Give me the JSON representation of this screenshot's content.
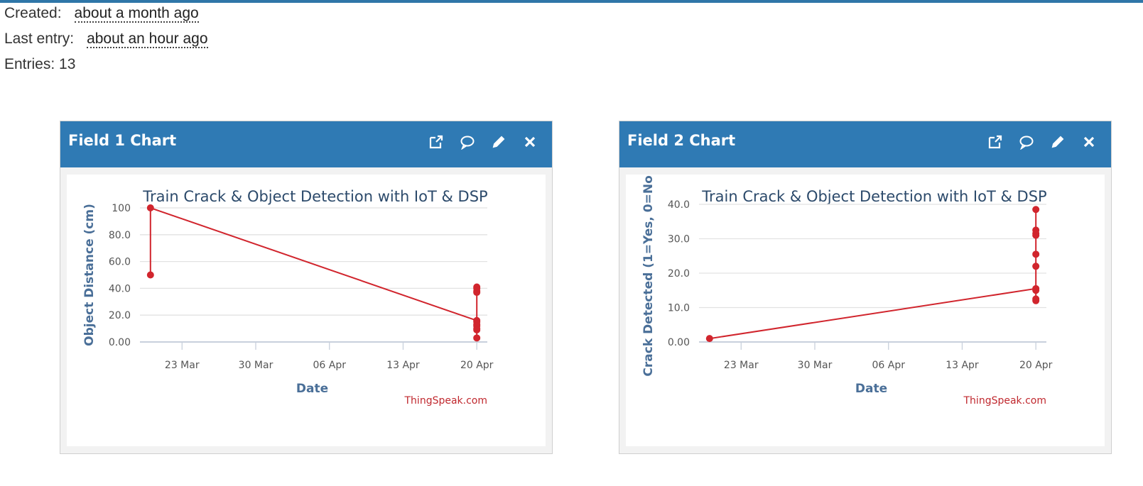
{
  "meta": {
    "created_label": "Created:",
    "created_value": "about a month ago",
    "last_entry_label": "Last entry:",
    "last_entry_value": "about an hour ago",
    "entries_label": "Entries: 13"
  },
  "colors": {
    "header": "#2f7ab4",
    "series": "#d1252d",
    "accent_bar": "#2f76a8"
  },
  "icons": [
    "external-link-icon",
    "comment-icon",
    "pencil-icon",
    "close-icon"
  ],
  "panels": [
    {
      "title": "Field 1 Chart"
    },
    {
      "title": "Field 2 Chart"
    }
  ],
  "chart_data": [
    {
      "type": "line",
      "title": "Train Crack & Object Detection with IoT & DSP",
      "xlabel": "Date",
      "ylabel": "Object Distance (cm)",
      "credit": "ThingSpeak.com",
      "x_ticks": [
        "23 Mar",
        "30 Mar",
        "06 Apr",
        "13 Apr",
        "20 Apr"
      ],
      "y_ticks": [
        "0.00",
        "20.0",
        "40.0",
        "60.0",
        "80.0",
        "100"
      ],
      "ylim": [
        0,
        100
      ],
      "xlim": [
        "2024-03-19",
        "2024-04-21"
      ],
      "grid": true,
      "series": [
        {
          "points": [
            {
              "x": "2024-03-20",
              "y": 50
            },
            {
              "x": "2024-03-20",
              "y": 100
            },
            {
              "x": "2024-04-20",
              "y": 16
            },
            {
              "x": "2024-04-20",
              "y": 15
            },
            {
              "x": "2024-04-20",
              "y": 13
            },
            {
              "x": "2024-04-20",
              "y": 12
            },
            {
              "x": "2024-04-20",
              "y": 10
            },
            {
              "x": "2024-04-20",
              "y": 9
            },
            {
              "x": "2024-04-20",
              "y": 3
            },
            {
              "x": "2024-04-20",
              "y": 37
            },
            {
              "x": "2024-04-20",
              "y": 38
            },
            {
              "x": "2024-04-20",
              "y": 40
            },
            {
              "x": "2024-04-20",
              "y": 41
            }
          ]
        }
      ]
    },
    {
      "type": "line",
      "title": "Train Crack & Object Detection with IoT & DSP",
      "xlabel": "Date",
      "ylabel": "Crack Detected (1=Yes, 0=No)",
      "credit": "ThingSpeak.com",
      "x_ticks": [
        "23 Mar",
        "30 Mar",
        "06 Apr",
        "13 Apr",
        "20 Apr"
      ],
      "y_ticks": [
        "0.00",
        "10.0",
        "20.0",
        "30.0",
        "40.0"
      ],
      "ylim": [
        0,
        40
      ],
      "xlim": [
        "2024-03-19",
        "2024-04-21"
      ],
      "grid": true,
      "series": [
        {
          "points": [
            {
              "x": "2024-03-20",
              "y": 1
            },
            {
              "x": "2024-04-20",
              "y": 15.5
            },
            {
              "x": "2024-04-20",
              "y": 12
            },
            {
              "x": "2024-04-20",
              "y": 12.5
            },
            {
              "x": "2024-04-20",
              "y": 15
            },
            {
              "x": "2024-04-20",
              "y": 22
            },
            {
              "x": "2024-04-20",
              "y": 25.5
            },
            {
              "x": "2024-04-20",
              "y": 31
            },
            {
              "x": "2024-04-20",
              "y": 31.5
            },
            {
              "x": "2024-04-20",
              "y": 32.5
            },
            {
              "x": "2024-04-20",
              "y": 38.5
            }
          ]
        }
      ]
    }
  ]
}
